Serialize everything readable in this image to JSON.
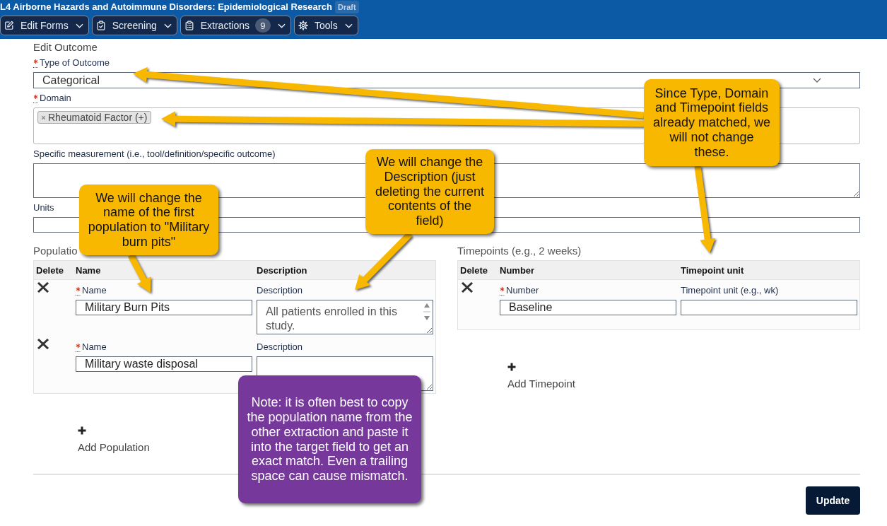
{
  "header": {
    "title": "L4 Airborne Hazards and Autoimmune Disorders: Epidemiological Research",
    "badge": "Draft",
    "menus": [
      {
        "label": "Edit Forms"
      },
      {
        "label": "Screening"
      },
      {
        "label": "Extractions",
        "count": "9"
      },
      {
        "label": "Tools"
      }
    ]
  },
  "form": {
    "heading": "Edit Outcome",
    "fields": [
      {
        "kind": "select",
        "label": "Type of Outcome",
        "required": true,
        "value": "Categorical"
      },
      {
        "kind": "tags",
        "label": "Domain",
        "required": true,
        "tags": [
          "Rheumatoid Factor (+)"
        ]
      },
      {
        "kind": "textarea",
        "label": "Specific measurement (i.e., tool/definition/specific outcome)",
        "required": false
      },
      {
        "kind": "input",
        "label": "Units",
        "required": false
      }
    ]
  },
  "populations": {
    "heading": "Populatio",
    "columns": [
      "Delete",
      "Name",
      "Description"
    ],
    "rows": [
      {
        "name_label": "Name",
        "name_required": true,
        "name": "Military Burn Pits",
        "description_label": "Description",
        "description": "All patients enrolled in this study."
      },
      {
        "name_label": "Name",
        "name_required": true,
        "name": "Military waste disposal",
        "description_label": "Description"
      }
    ],
    "add_label": "Add Population"
  },
  "timepoints": {
    "heading": "Timepoints (e.g., 2 weeks)",
    "columns": [
      "Delete",
      "Number",
      "Timepoint unit"
    ],
    "rows": [
      {
        "number_label": "Number",
        "number_required": true,
        "number": "Baseline",
        "unit_label": "Timepoint unit (e.g., wk)"
      }
    ],
    "add_label": "Add Timepoint"
  },
  "actions": {
    "update": "Update"
  },
  "annotations": [
    {
      "color": "#f9b800",
      "text": "Since Type, Domain and Timepoint fields already matched, we will not change these."
    },
    {
      "color": "#f9b800",
      "text": "We will change the Description (just deleting the current contents of the field)"
    },
    {
      "color": "#f9b800",
      "text": "We will change the name of the first population to \"Military burn pits\""
    },
    {
      "color": "#76389a",
      "text": "Note: it is often best to copy the population name from the other extraction and paste it into the target field to get an exact match. Even a trailing space can cause mismatch."
    }
  ]
}
